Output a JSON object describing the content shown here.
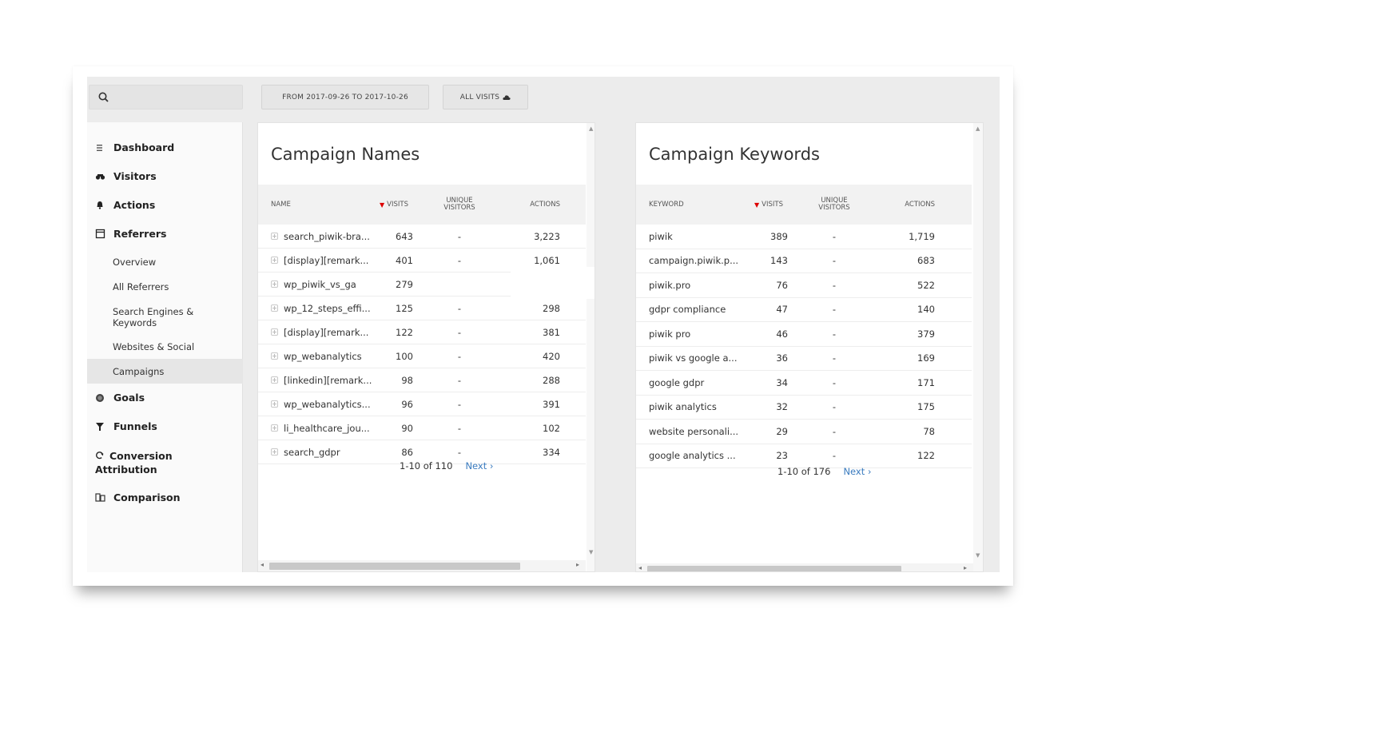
{
  "topbar": {
    "date_range_label": "FROM 2017-09-26 TO 2017-10-26",
    "segment_label": "ALL VISITS",
    "segment_icon": "cloud-icon",
    "search_icon": "search-icon"
  },
  "sidebar": {
    "items": [
      {
        "label": "Dashboard",
        "icon": "hamburger-icon"
      },
      {
        "label": "Visitors",
        "icon": "binoculars-icon"
      },
      {
        "label": "Actions",
        "icon": "bell-icon"
      },
      {
        "label": "Referrers",
        "icon": "window-icon"
      },
      {
        "label": "Goals",
        "icon": "target-icon"
      },
      {
        "label": "Funnels",
        "icon": "funnel-icon"
      },
      {
        "label": "Conversion Attribution",
        "icon": "refresh-icon"
      },
      {
        "label": "Comparison",
        "icon": "compare-icon"
      }
    ],
    "referrer_subitems": [
      {
        "label": "Overview"
      },
      {
        "label": "All Referrers"
      },
      {
        "label": "Search Engines & Keywords"
      },
      {
        "label": "Websites & Social"
      },
      {
        "label": "Campaigns"
      }
    ]
  },
  "campaign_names": {
    "title": "Campaign Names",
    "columns": {
      "name": "NAME",
      "visits": "VISITS",
      "unique_visitors": "UNIQUE VISITORS",
      "actions": "ACTIONS"
    },
    "rows": [
      {
        "name": "search_piwik-bra...",
        "visits": "643",
        "unique": "-",
        "actions": "3,223"
      },
      {
        "name": "[display][remark...",
        "visits": "401",
        "unique": "-",
        "actions": "1,061"
      },
      {
        "name": "wp_piwik_vs_ga",
        "visits": "279",
        "unique": "",
        "actions": ""
      },
      {
        "name": "wp_12_steps_effi...",
        "visits": "125",
        "unique": "-",
        "actions": "298"
      },
      {
        "name": "[display][remark...",
        "visits": "122",
        "unique": "-",
        "actions": "381"
      },
      {
        "name": "wp_webanalytics",
        "visits": "100",
        "unique": "-",
        "actions": "420"
      },
      {
        "name": "[linkedin][remark...",
        "visits": "98",
        "unique": "-",
        "actions": "288"
      },
      {
        "name": "wp_webanalytics...",
        "visits": "96",
        "unique": "-",
        "actions": "391"
      },
      {
        "name": "li_healthcare_jou...",
        "visits": "90",
        "unique": "-",
        "actions": "102"
      },
      {
        "name": "search_gdpr",
        "visits": "86",
        "unique": "-",
        "actions": "334"
      }
    ],
    "pagination": {
      "range": "1-10 of 110",
      "next": "Next ›"
    }
  },
  "campaign_keywords": {
    "title": "Campaign Keywords",
    "columns": {
      "keyword": "KEYWORD",
      "visits": "VISITS",
      "unique_visitors": "UNIQUE VISITORS",
      "actions": "ACTIONS"
    },
    "rows": [
      {
        "keyword": "piwik",
        "visits": "389",
        "unique": "-",
        "actions": "1,719"
      },
      {
        "keyword": "campaign.piwik.p...",
        "visits": "143",
        "unique": "-",
        "actions": "683"
      },
      {
        "keyword": "piwik.pro",
        "visits": "76",
        "unique": "-",
        "actions": "522"
      },
      {
        "keyword": "gdpr compliance",
        "visits": "47",
        "unique": "-",
        "actions": "140"
      },
      {
        "keyword": "piwik pro",
        "visits": "46",
        "unique": "-",
        "actions": "379"
      },
      {
        "keyword": "piwik vs google a...",
        "visits": "36",
        "unique": "-",
        "actions": "169"
      },
      {
        "keyword": "google gdpr",
        "visits": "34",
        "unique": "-",
        "actions": "171"
      },
      {
        "keyword": "piwik analytics",
        "visits": "32",
        "unique": "-",
        "actions": "175"
      },
      {
        "keyword": "website personali...",
        "visits": "29",
        "unique": "-",
        "actions": "78"
      },
      {
        "keyword": "google analytics ...",
        "visits": "23",
        "unique": "-",
        "actions": "122"
      }
    ],
    "pagination": {
      "range": "1-10 of 176",
      "next": "Next ›"
    }
  },
  "colors": {
    "sort_arrow": "#dd0000",
    "link": "#3a7bbf",
    "active_nav": "#e6e6e6"
  }
}
